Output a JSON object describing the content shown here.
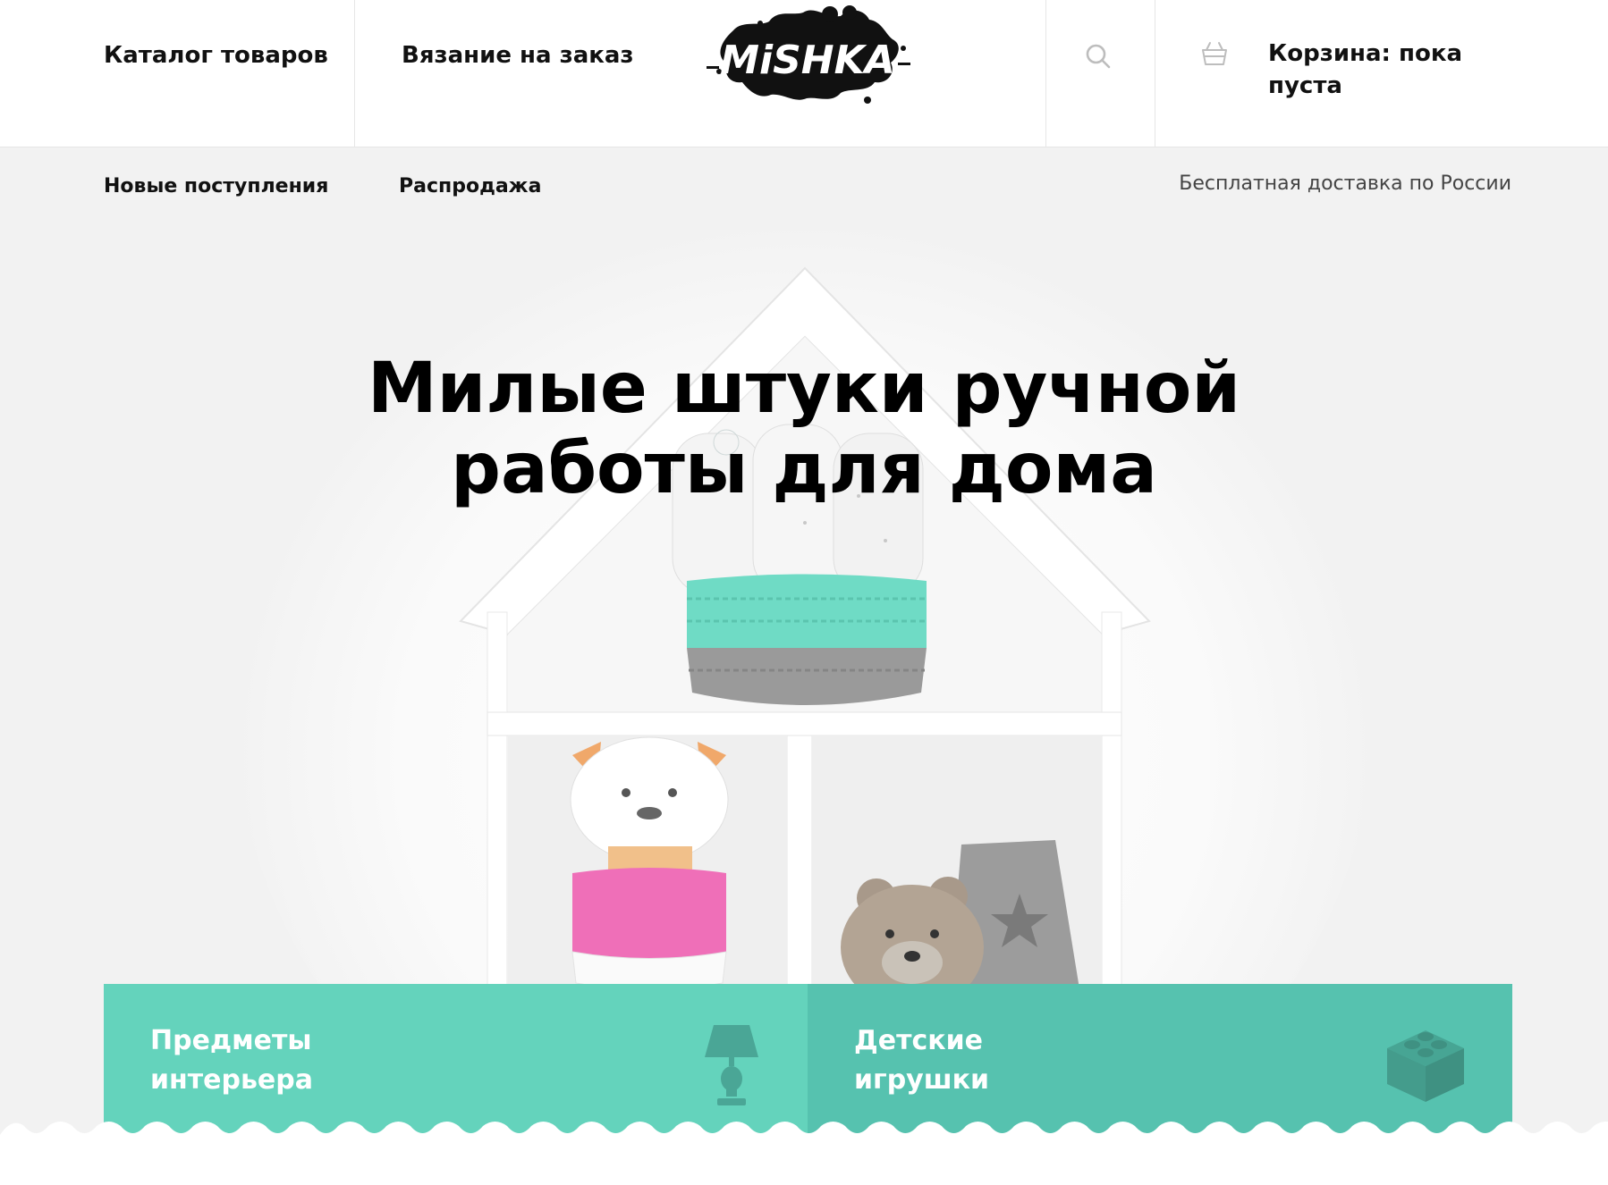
{
  "header": {
    "nav": {
      "catalog": "Каталог товаров",
      "knitting": "Вязание на заказ"
    },
    "logo_text": "MiSHKA",
    "search_icon": "search-icon",
    "cart": {
      "icon": "basket-icon",
      "line1": "Корзина: пока",
      "line2": "пуста"
    }
  },
  "subnav": {
    "new_arrivals": "Новые поступления",
    "sale": "Распродажа",
    "delivery": "Бесплатная доставка по России"
  },
  "hero": {
    "title_line1": "Милые штуки ручной",
    "title_line2": "работы для дома"
  },
  "categories": [
    {
      "line1": "Предметы",
      "line2": "интерьера",
      "icon": "lamp-icon"
    },
    {
      "line1": "Детские",
      "line2": "игрушки",
      "icon": "toy-brick-icon"
    }
  ],
  "colors": {
    "teal_light": "#64d3bc",
    "teal_dark": "#56c2af",
    "background": "#f2f2f2"
  }
}
